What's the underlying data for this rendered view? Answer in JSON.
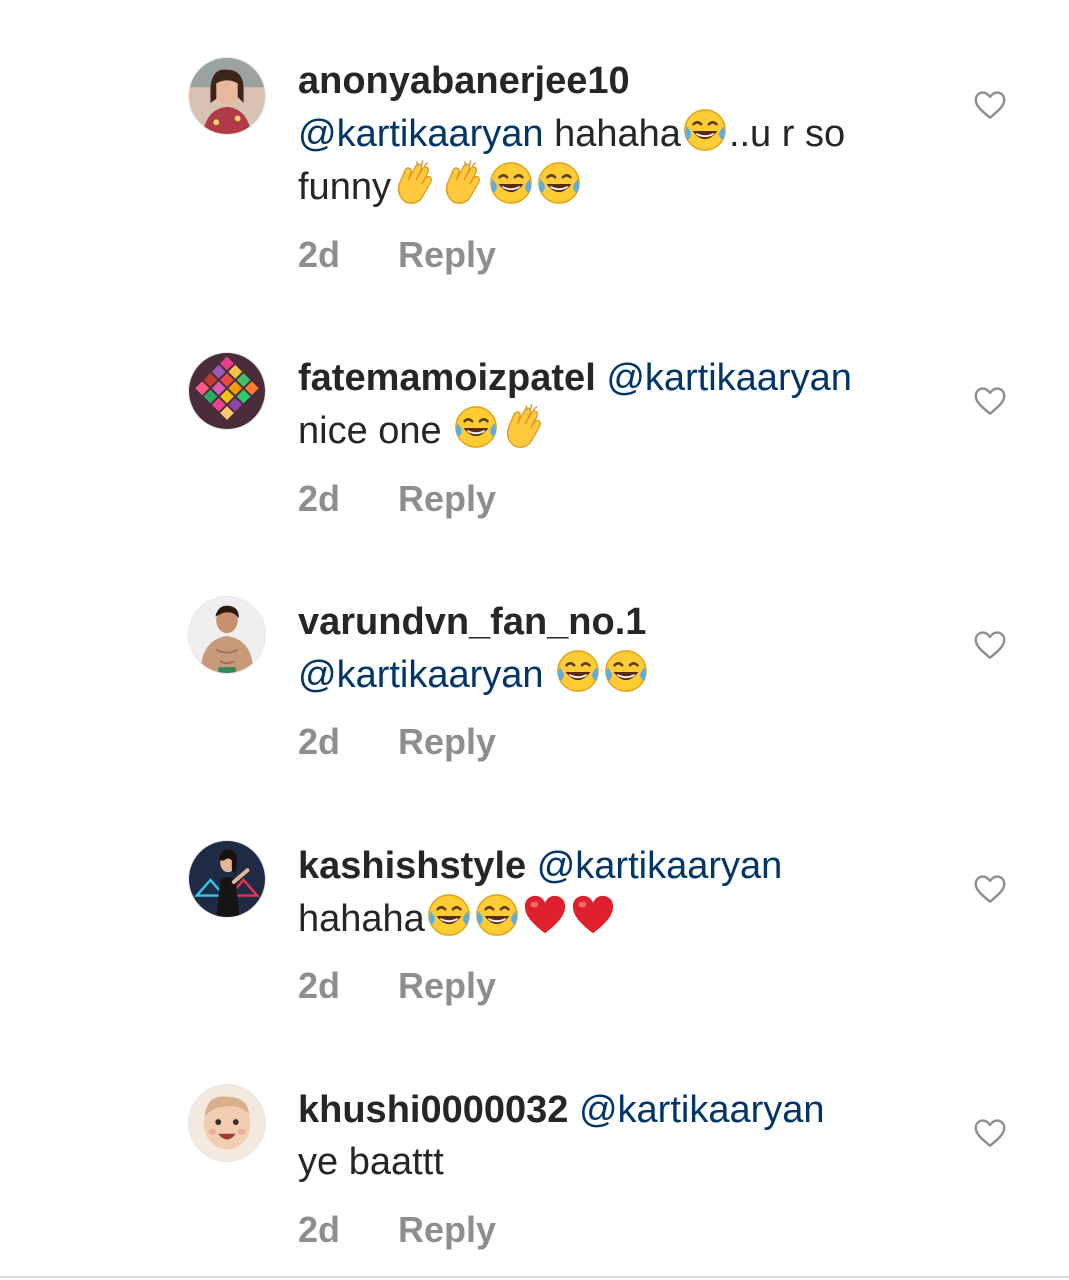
{
  "comments": [
    {
      "username": "anonyabanerjee10",
      "mention": "@kartikaaryan",
      "text_parts": [
        "hahaha",
        "..u r so funny"
      ],
      "time": "2d",
      "reply_label": "Reply",
      "avatar_color": "#b03a48"
    },
    {
      "username": "fatemamoizpatel",
      "mention": "@kartikaaryan",
      "text_parts": [
        "nice one "
      ],
      "time": "2d",
      "reply_label": "Reply",
      "avatar_color": "#7d2f5e"
    },
    {
      "username": "varundvn_fan_no.1",
      "mention": "@kartikaaryan",
      "text_parts": [],
      "time": "2d",
      "reply_label": "Reply",
      "avatar_color": "#c99a7a"
    },
    {
      "username": "kashishstyle",
      "mention": "@kartikaaryan",
      "text_parts": [
        "hahaha"
      ],
      "time": "2d",
      "reply_label": "Reply",
      "avatar_color": "#1f2a44"
    },
    {
      "username": "khushi0000032",
      "mention": "@kartikaaryan",
      "text_parts": [
        "ye baattt"
      ],
      "time": "2d",
      "reply_label": "Reply",
      "avatar_color": "#d9c3b0"
    }
  ],
  "colors": {
    "text": "#262626",
    "mention": "#003569",
    "meta": "#8e8e8e",
    "like_icon": "#8e8e8e"
  },
  "icons": {
    "like": "heart-outline-icon",
    "laugh": "face-with-tears-of-joy-emoji",
    "clap": "clapping-hands-emoji",
    "heart": "red-heart-emoji"
  }
}
